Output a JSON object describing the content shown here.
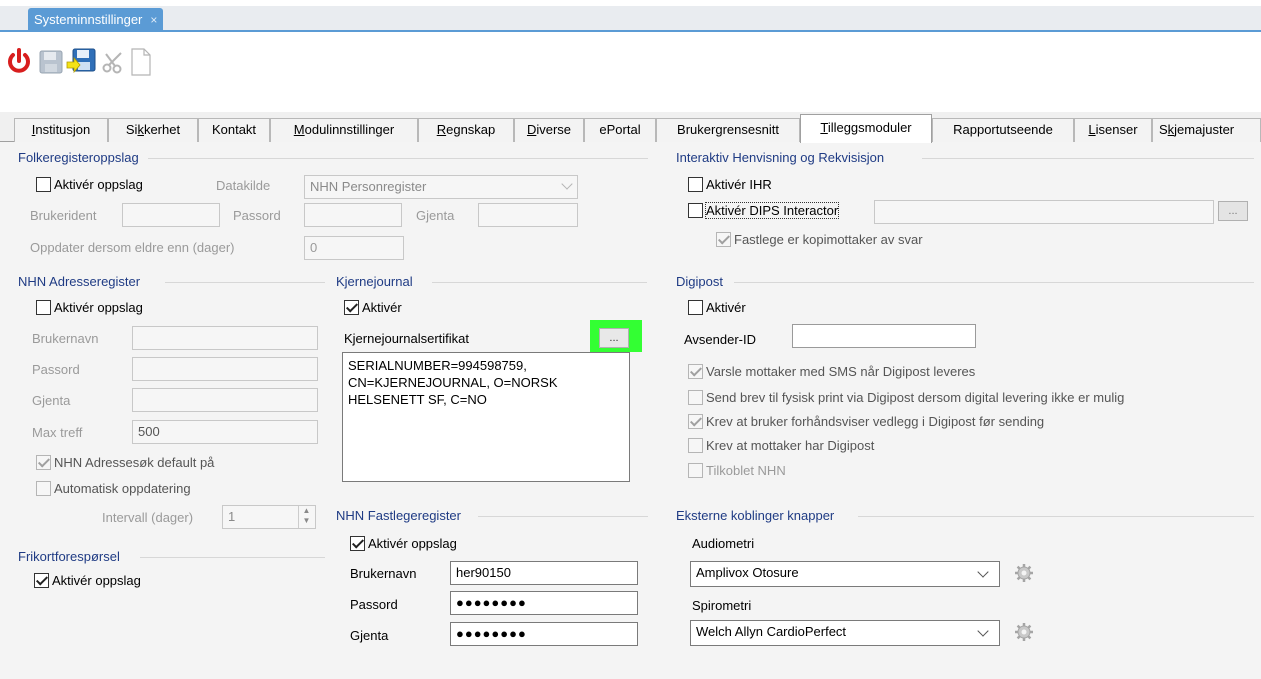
{
  "window_tab": {
    "label": "Systeminnstillinger",
    "close": "×"
  },
  "toolbar": {
    "power": "power-icon",
    "save": "save-icon",
    "save_close": "save-close-icon",
    "cut": "cut-icon",
    "new": "new-document-icon"
  },
  "tabs": [
    {
      "pre": "",
      "u": "I",
      "post": "nstitusjon"
    },
    {
      "pre": "Si",
      "u": "k",
      "post": "kerhet"
    },
    {
      "pre": "Kontakt",
      "u": "",
      "post": ""
    },
    {
      "pre": "",
      "u": "M",
      "post": "odulinnstillinger"
    },
    {
      "pre": "",
      "u": "R",
      "post": "egnskap"
    },
    {
      "pre": "",
      "u": "D",
      "post": "iverse"
    },
    {
      "pre": "ePortal",
      "u": "",
      "post": ""
    },
    {
      "pre": "Brukergrensesnitt",
      "u": "",
      "post": ""
    },
    {
      "pre": "",
      "u": "T",
      "post": "illeggsmoduler"
    },
    {
      "pre": "Rapportutseende",
      "u": "",
      "post": ""
    },
    {
      "pre": "",
      "u": "L",
      "post": "isenser"
    },
    {
      "pre": "S",
      "u": "k",
      "post": "jemajuster"
    }
  ],
  "folkeregister": {
    "title": "Folkeregisteroppslag",
    "aktiver": "Aktivér oppslag",
    "datakilde_label": "Datakilde",
    "datakilde_value": "NHN Personregister",
    "brukerident": "Brukerident",
    "passord": "Passord",
    "gjenta": "Gjenta",
    "oppdater_label": "Oppdater dersom eldre enn (dager)",
    "oppdater_value": "0"
  },
  "ihr": {
    "title": "Interaktiv Henvisning og Rekvisisjon",
    "aktiver_ihr": "Aktivér IHR",
    "aktiver_dips": "Aktivér DIPS Interactor",
    "dots": "...",
    "fastlege": "Fastlege er kopimottaker av svar"
  },
  "adresse": {
    "title": "NHN Adresseregister",
    "aktiver": "Aktivér oppslag",
    "brukernavn": "Brukernavn",
    "passord": "Passord",
    "gjenta": "Gjenta",
    "max_treff": "Max treff",
    "max_treff_value": "500",
    "default_paa": "NHN Adressesøk default på",
    "auto": "Automatisk oppdatering",
    "intervall": "Intervall (dager)",
    "intervall_value": "1"
  },
  "kjernejournal": {
    "title": "Kjernejournal",
    "aktiver": "Aktivér",
    "sertifikat": "Kjernejournalsertifikat",
    "dots": "...",
    "cert_text": "SERIALNUMBER=994598759, CN=KJERNEJOURNAL, O=NORSK HELSENETT SF, C=NO",
    "highlight_color": "#33ff33"
  },
  "digipost": {
    "title": "Digipost",
    "aktiver": "Aktivér",
    "avsender": "Avsender-ID",
    "opt1": "Varsle mottaker med SMS når Digipost leveres",
    "opt2": "Send brev til fysisk print via Digipost dersom digital levering ikke er mulig",
    "opt3": "Krev at bruker forhåndsviser vedlegg i Digipost før sending",
    "opt4": "Krev at mottaker har Digipost",
    "opt5": "Tilkoblet NHN"
  },
  "frikort": {
    "title": "Frikortforespørsel",
    "aktiver": "Aktivér oppslag"
  },
  "fastlege": {
    "title": "NHN Fastlegeregister",
    "aktiver": "Aktivér oppslag",
    "brukernavn": "Brukernavn",
    "brukernavn_value": "her90150",
    "passord": "Passord",
    "passord_value": "●●●●●●●●",
    "gjenta": "Gjenta",
    "gjenta_value": "●●●●●●●●"
  },
  "eksterne": {
    "title": "Eksterne koblinger knapper",
    "audiometri": "Audiometri",
    "audiometri_value": "Amplivox Otosure",
    "spirometri": "Spirometri",
    "spirometri_value": "Welch Allyn CardioPerfect"
  }
}
